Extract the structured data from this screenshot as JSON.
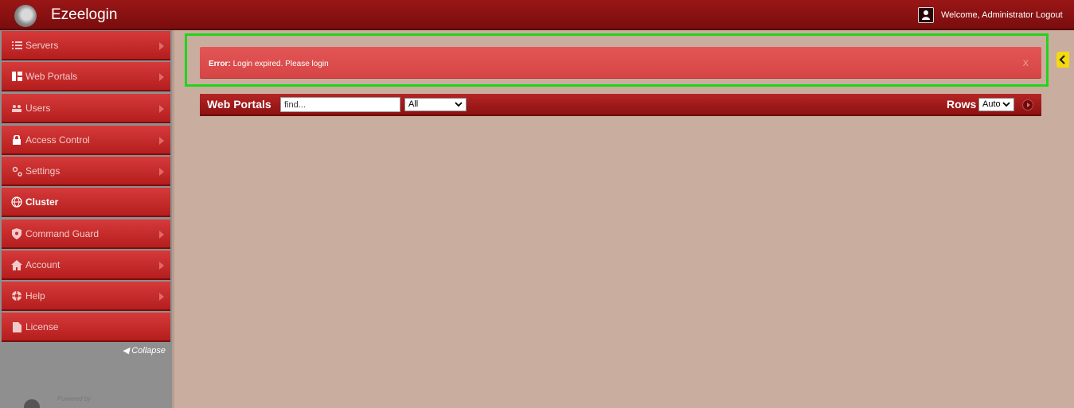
{
  "app": {
    "title": "Ezeelogin"
  },
  "header": {
    "welcome": "Welcome, Administrator",
    "logout": "Logout"
  },
  "sidebar": {
    "items": [
      {
        "label": "Servers",
        "icon": "list-icon"
      },
      {
        "label": "Web Portals",
        "icon": "grid-icon"
      },
      {
        "label": "Users",
        "icon": "users-icon"
      },
      {
        "label": "Access Control",
        "icon": "lock-icon"
      },
      {
        "label": "Settings",
        "icon": "gears-icon"
      },
      {
        "label": "Cluster",
        "icon": "globe-icon",
        "active": true
      },
      {
        "label": "Command Guard",
        "icon": "shield-icon"
      },
      {
        "label": "Account",
        "icon": "home-icon"
      },
      {
        "label": "Help",
        "icon": "lifebuoy-icon"
      },
      {
        "label": "License",
        "icon": "document-icon"
      }
    ],
    "collapse": "◀ Collapse",
    "powered_by": "Powered by"
  },
  "alert": {
    "prefix": "Error:",
    "message": " Login expired. Please login",
    "close": "X"
  },
  "toolbar": {
    "title": "Web Portals",
    "search_placeholder": "find...",
    "filter_value": "All",
    "rows_label": "Rows",
    "rows_value": "Auto"
  },
  "colors": {
    "brand": "#9a1616",
    "alert": "#e04e4e",
    "highlight": "#22d41a",
    "toggle": "#f5d90f"
  }
}
